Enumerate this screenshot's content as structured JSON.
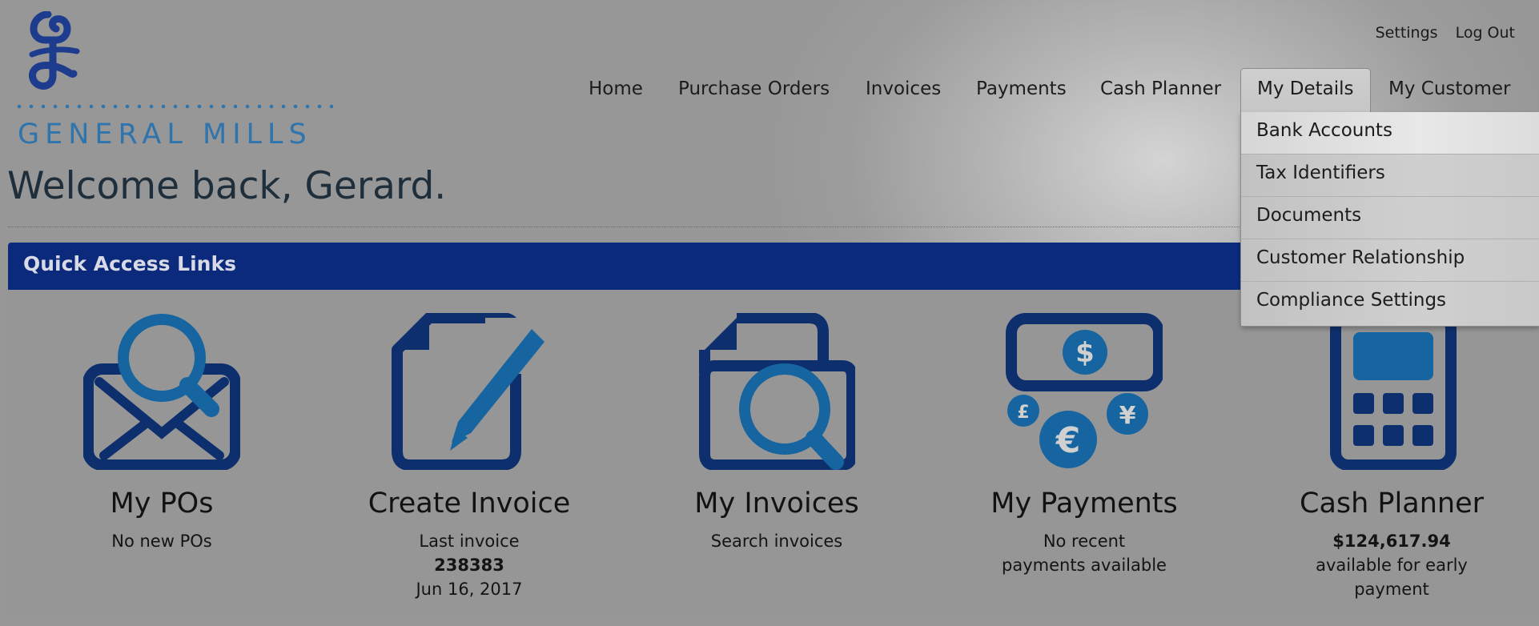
{
  "brand": {
    "name": "GENERAL MILLS",
    "logo_color": "#2f74ad",
    "g_color": "#1d3c8e"
  },
  "util_links": {
    "settings": "Settings",
    "logout": "Log Out"
  },
  "nav": [
    {
      "label": "Home"
    },
    {
      "label": "Purchase Orders"
    },
    {
      "label": "Invoices"
    },
    {
      "label": "Payments"
    },
    {
      "label": "Cash Planner"
    },
    {
      "label": "My Details",
      "active": true
    },
    {
      "label": "My Customer"
    }
  ],
  "dropdown": [
    {
      "label": "Bank Accounts"
    },
    {
      "label": "Tax Identifiers"
    },
    {
      "label": "Documents"
    },
    {
      "label": "Customer Relationship"
    },
    {
      "label": "Compliance Settings"
    }
  ],
  "welcome": "Welcome back, Gerard.",
  "quick_access": {
    "title": "Quick Access Links",
    "tiles": [
      {
        "icon": "envelope-search-icon",
        "title": "My POs",
        "line1": "No new POs"
      },
      {
        "icon": "document-pencil-icon",
        "title": "Create Invoice",
        "line1": "Last invoice",
        "line2": "238383",
        "line3": "Jun 16, 2017"
      },
      {
        "icon": "document-search-icon",
        "title": "My Invoices",
        "line1": "Search invoices"
      },
      {
        "icon": "currency-icon",
        "title": "My Payments",
        "line1": "No recent",
        "line2": "payments available"
      },
      {
        "icon": "calculator-icon",
        "title": "Cash Planner",
        "line1": "$124,617.94",
        "line2": "available for early",
        "line3": "payment"
      }
    ]
  },
  "colors": {
    "icon_dark": "#0e2f6e",
    "icon_light": "#1665a0",
    "header_blue": "#0b2a7b"
  }
}
